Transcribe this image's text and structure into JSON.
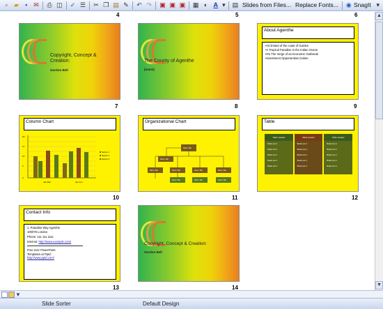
{
  "toolbar": {
    "slides_from_files": "Slides from Files...",
    "replace_fonts": "Replace Fonts...",
    "snagit": "SnagIt"
  },
  "status": {
    "view": "Slide Sorter",
    "design": "Default Design"
  },
  "top_numbers": [
    "4",
    "5",
    "6"
  ],
  "slides": [
    {
      "number": "7",
      "title": "Copyright, Concept & Creation:",
      "author": "Gordon Bell"
    },
    {
      "number": "8",
      "title": "The County of Agenthe",
      "author": "[name]"
    },
    {
      "number": "9",
      "title": "About Agenthe",
      "bullets": [
        "As limited of the coast of Garden",
        "A Tropical Paradise in the Indian Ocean",
        "On The Verge of an Economic Outbreak",
        "Investment Opportunities Galore"
      ]
    },
    {
      "number": "10",
      "title": "Column Chart",
      "legend": [
        "Series 1",
        "Series 2",
        "Series 3"
      ],
      "x_labels": [
        "Jan-Mar",
        "Apr-Jun"
      ],
      "y_ticks": [
        "18",
        "16",
        "14",
        "12",
        "10",
        "8",
        "6",
        "4",
        "2",
        "0"
      ]
    },
    {
      "number": "11",
      "title": "Organizational Chart",
      "box_text": "Name Title"
    },
    {
      "number": "12",
      "title": "Table",
      "headers": [
        "Table Header",
        "Table Header",
        "Table Header"
      ],
      "cell": "Bullet text 1"
    },
    {
      "number": "13",
      "title": "Contact Info",
      "address": "1, Paradise Way Agenthe 100075 London",
      "phone": "Phone: 111 111 1111",
      "internet_label": "Internet:",
      "internet": "http://www.example.com/",
      "free_label": "Free ever PowerPoint Templates at Pptd:",
      "free_link": "http://www.pptd.com/"
    },
    {
      "number": "14",
      "title": "Copyright, Concept & Creation:",
      "author": "Gordon Bell"
    }
  ]
}
